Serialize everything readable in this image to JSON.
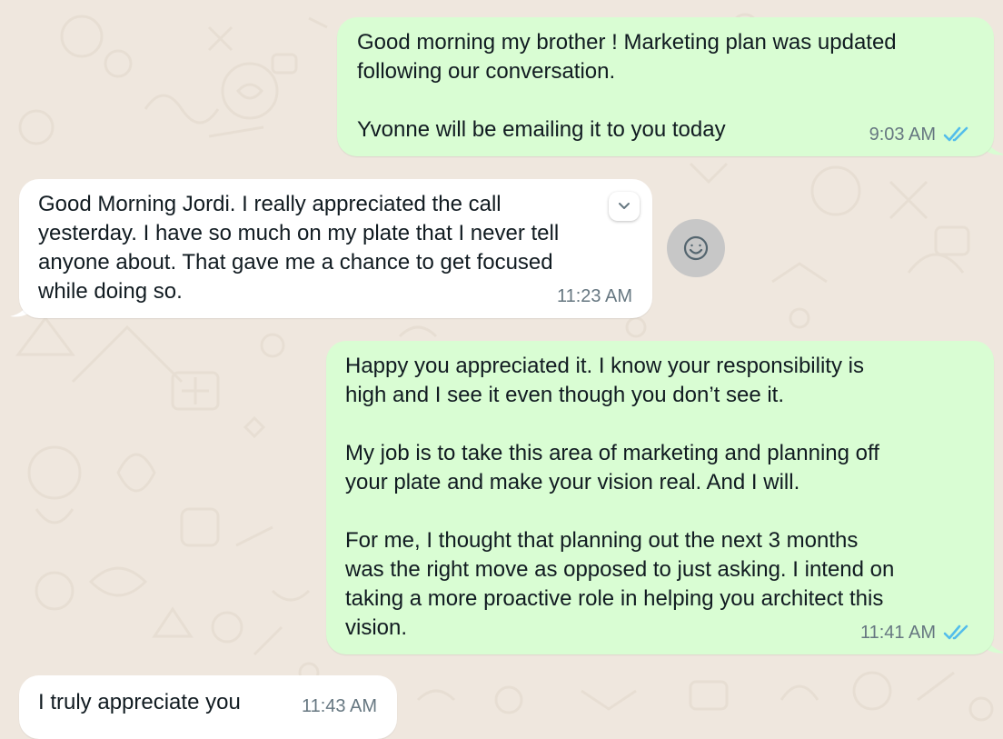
{
  "chat": {
    "messages": [
      {
        "direction": "outgoing",
        "text": "Good morning my brother ! Marketing plan was updated\nfollowing our conversation.\n\nYvonne will be emailing it to you today",
        "time": "9:03 AM",
        "status": "read",
        "status_icon": "double-check-icon"
      },
      {
        "direction": "incoming",
        "text": "Good Morning Jordi. I really appreciated the call\nyesterday. I have so much on my plate that I never tell\nanyone about. That gave me a chance to get focused\nwhile doing so.",
        "time": "11:23 AM",
        "menu_icon": "chevron-down-icon"
      },
      {
        "direction": "outgoing",
        "text": "Happy you appreciated it. I know your responsibility is\nhigh and I see it even though you don’t see it.\n\nMy job is to take this area of marketing and planning off\nyour plate and make your vision real. And I will.\n\nFor me, I thought that planning out the next 3 months\nwas the right move as opposed to just asking. I intend on\ntaking a more proactive role in helping you architect this\nvision.",
        "time": "11:41 AM",
        "status": "read",
        "status_icon": "double-check-icon"
      },
      {
        "direction": "incoming",
        "text": "I truly appreciate you",
        "time": "11:43 AM"
      }
    ],
    "reaction_button_icon": "smiley-icon"
  },
  "colors": {
    "background": "#EFE7DE",
    "outgoing_bubble": "#D9FDD3",
    "incoming_bubble": "#FFFFFF",
    "read_ticks": "#53BDEB",
    "timestamp": "#667781",
    "text": "#111B21"
  }
}
